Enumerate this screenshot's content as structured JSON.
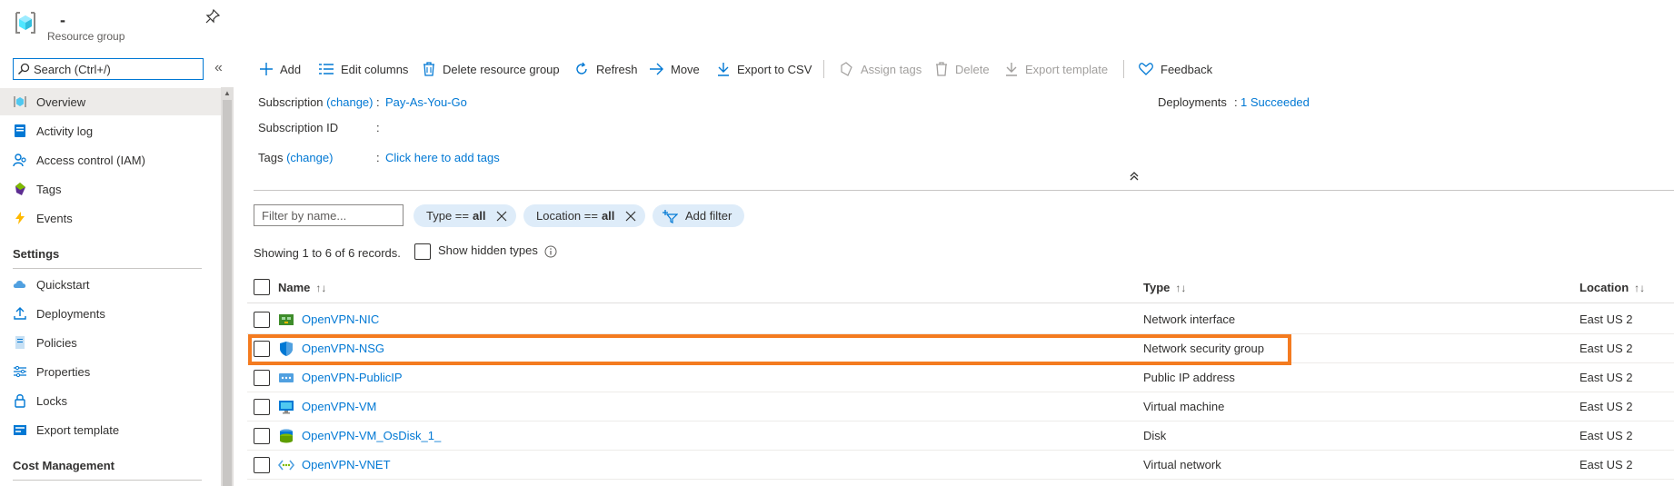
{
  "header": {
    "resource_name": "-",
    "resource_type": "Resource group"
  },
  "sidebar": {
    "search_placeholder": "Search (Ctrl+/)",
    "collapse_glyph": "«",
    "items": [
      {
        "label": "Overview",
        "icon": "overview-icon"
      },
      {
        "label": "Activity log",
        "icon": "activity-log-icon"
      },
      {
        "label": "Access control (IAM)",
        "icon": "iam-icon"
      },
      {
        "label": "Tags",
        "icon": "tag-icon"
      },
      {
        "label": "Events",
        "icon": "lightning-icon"
      }
    ],
    "settings_header": "Settings",
    "settings_items": [
      {
        "label": "Quickstart",
        "icon": "cloud-icon"
      },
      {
        "label": "Deployments",
        "icon": "upload-icon"
      },
      {
        "label": "Policies",
        "icon": "policy-icon"
      },
      {
        "label": "Properties",
        "icon": "sliders-icon"
      },
      {
        "label": "Locks",
        "icon": "lock-icon"
      },
      {
        "label": "Export template",
        "icon": "export-template-icon"
      }
    ],
    "cost_header": "Cost Management"
  },
  "toolbar": {
    "add": "Add",
    "edit_columns": "Edit columns",
    "delete_rg": "Delete resource group",
    "refresh": "Refresh",
    "move": "Move",
    "export_csv": "Export to CSV",
    "assign_tags": "Assign tags",
    "delete": "Delete",
    "export_template": "Export template",
    "feedback": "Feedback"
  },
  "essentials": {
    "subscription_label": "Subscription",
    "change": "(change)",
    "subscription_value": "Pay-As-You-Go",
    "subscription_id_label": "Subscription ID",
    "tags_label": "Tags",
    "tags_value": "Click here to add tags",
    "deployments_label": "Deployments",
    "deployments_value": "1 Succeeded",
    "colon": ":"
  },
  "filters": {
    "name_placeholder": "Filter by name...",
    "type_filter": {
      "label": "Type ==",
      "value": "all"
    },
    "location_filter": {
      "label": "Location ==",
      "value": "all"
    },
    "add_filter": "Add filter",
    "records_text": "Showing 1 to 6 of 6 records.",
    "show_hidden": "Show hidden types"
  },
  "table": {
    "columns": {
      "name": "Name",
      "type": "Type",
      "location": "Location"
    },
    "sort_glyph": "↑↓",
    "rows": [
      {
        "name": "OpenVPN-NIC",
        "type": "Network interface",
        "location": "East US 2",
        "icon": "network-interface-icon"
      },
      {
        "name": "OpenVPN-NSG",
        "type": "Network security group",
        "location": "East US 2",
        "icon": "shield-icon"
      },
      {
        "name": "OpenVPN-PublicIP",
        "type": "Public IP address",
        "location": "East US 2",
        "icon": "public-ip-icon"
      },
      {
        "name": "OpenVPN-VM",
        "type": "Virtual machine",
        "location": "East US 2",
        "icon": "monitor-icon"
      },
      {
        "name": "OpenVPN-VM_OsDisk_1_",
        "type": "Disk",
        "location": "East US 2",
        "icon": "disk-icon"
      },
      {
        "name": "OpenVPN-VNET",
        "type": "Virtual network",
        "location": "East US 2",
        "icon": "vnet-icon"
      }
    ]
  },
  "colors": {
    "accent": "#0078d4",
    "highlight": "#f47b20",
    "pill_bg": "#deecf9"
  }
}
